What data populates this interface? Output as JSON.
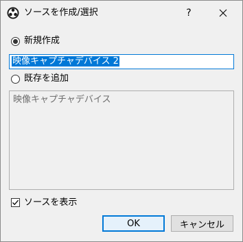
{
  "window": {
    "title": "ソースを作成/選択",
    "help_label": "?"
  },
  "create_new": {
    "label": "新規作成",
    "selected": true,
    "input_value": "映像キャプチャデバイス 2"
  },
  "add_existing": {
    "label": "既存を追加",
    "selected": false,
    "items": [
      "映像キャプチャデバイス"
    ]
  },
  "visible_checkbox": {
    "label": "ソースを表示",
    "checked": true
  },
  "buttons": {
    "ok_label": "OK",
    "cancel_label": "キャンセル"
  },
  "colors": {
    "accent": "#0078d7",
    "background": "#f0f0f0"
  }
}
